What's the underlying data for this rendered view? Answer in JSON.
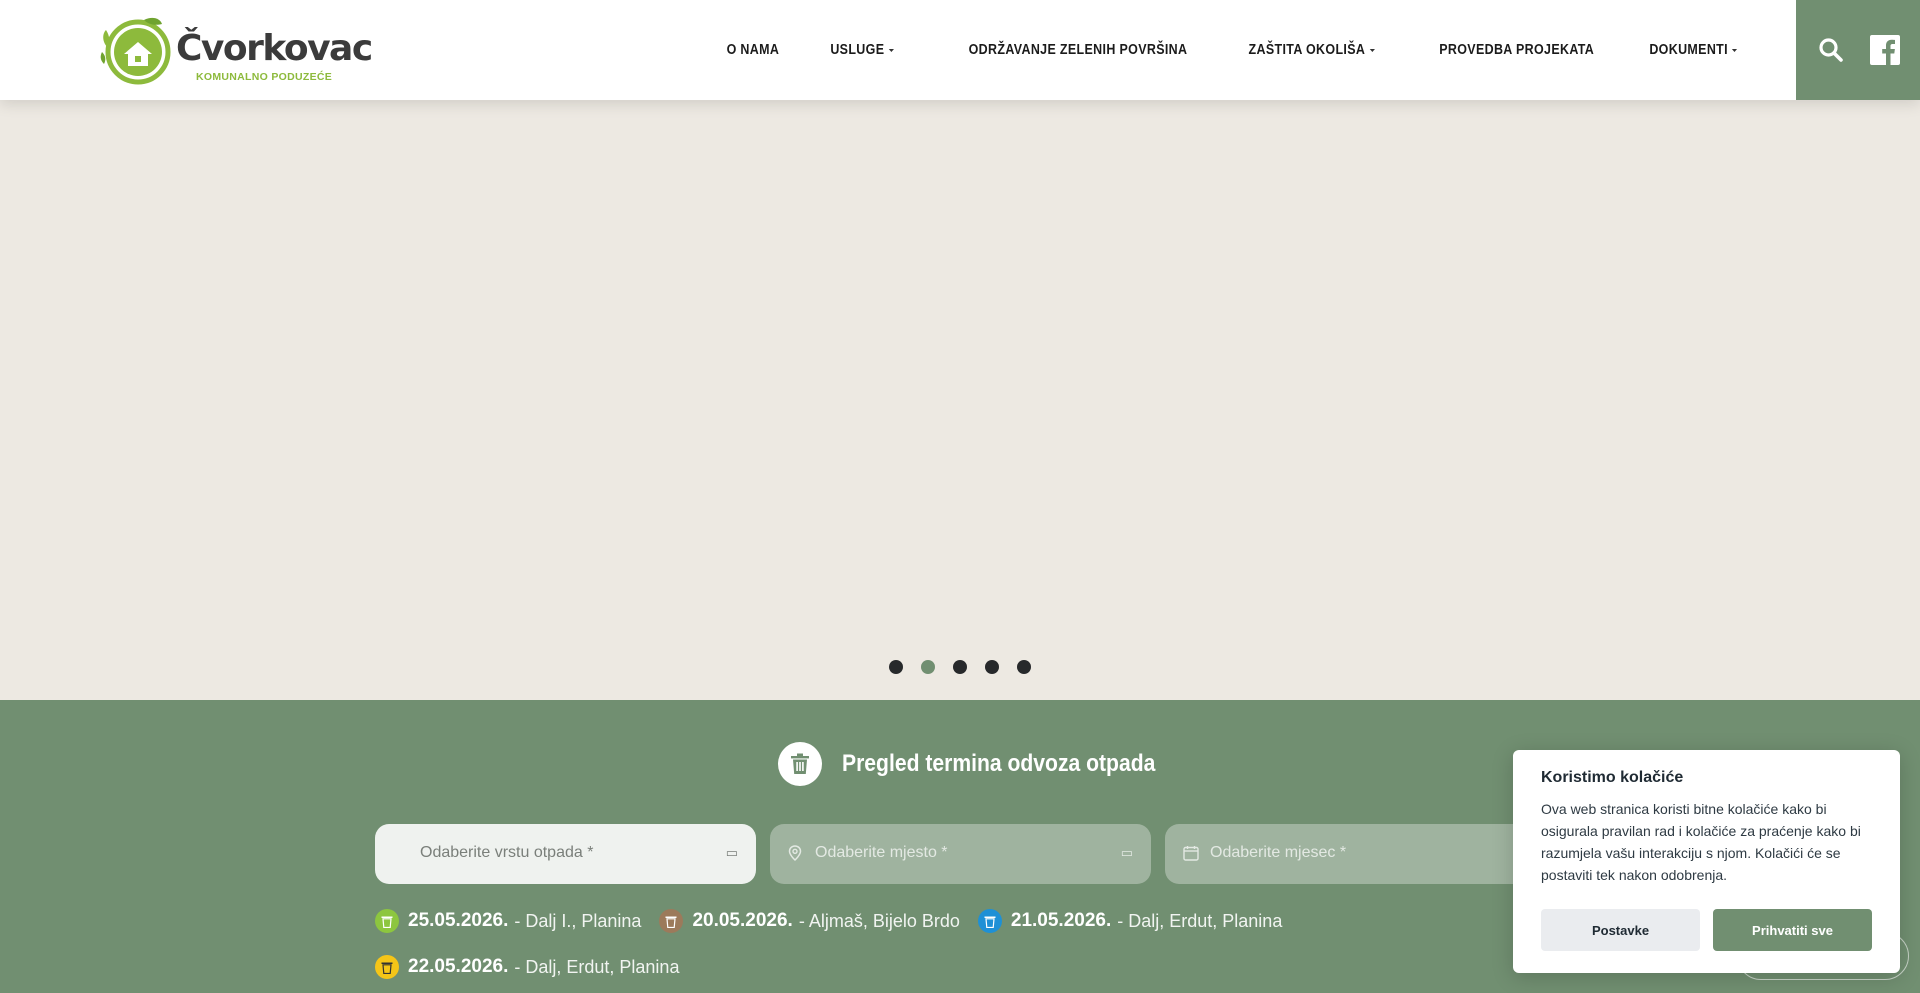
{
  "brand": {
    "name": "Čvorkovac",
    "subtitle": "KOMUNALNO PODUZEĆE",
    "colors": {
      "green": "#718f71",
      "logo_green": "#8dba3c",
      "text_dark": "#1b1b1b"
    }
  },
  "nav": {
    "items": [
      {
        "label": "O NAMA",
        "dropdown": false
      },
      {
        "label": "USLUGE",
        "dropdown": true
      },
      {
        "label": "ODRŽAVANJE ZELENIH POVRŠINA",
        "dropdown": false
      },
      {
        "label": "ZAŠTITA OKOLIŠA",
        "dropdown": true
      },
      {
        "label": "PROVEDBA PROJEKATA",
        "dropdown": false
      },
      {
        "label": "DOKUMENTI",
        "dropdown": true
      }
    ],
    "actions": [
      "search-icon",
      "facebook-icon"
    ]
  },
  "hero": {
    "slides_count": 5,
    "active_slide": 2
  },
  "waste": {
    "title": "Pregled termina odvoza otpada",
    "selects": {
      "type_placeholder": "Odaberite vrstu otpada *",
      "place_placeholder": "Odaberite mjesto *",
      "month_placeholder": "Odaberite mjesec *"
    },
    "schedule": [
      {
        "date": "25.05.2026.",
        "places": "- Dalj I., Planina",
        "icon_color": "#8dc63f"
      },
      {
        "date": "20.05.2026.",
        "places": "- Aljmaš, Bijelo Brdo",
        "icon_color": "#9c7a5b"
      },
      {
        "date": "21.05.2026.",
        "places": "- Dalj, Erdut, Planina",
        "icon_color": "#1e90d6"
      },
      {
        "date": "22.05.2026.",
        "places": "- Dalj, Erdut, Planina",
        "icon_color": "#f5c518"
      }
    ]
  },
  "cookie": {
    "title": "Koristimo kolačiće",
    "text": "Ova web stranica koristi bitne kolačiće kako bi osigurala pravilan rad i kolačiće za praćenje kako bi razumjela vašu interakciju s njom. Kolačići će se postaviti tek nakon odobrenja.",
    "settings_label": "Postavke",
    "accept_label": "Prihvatiti sve"
  }
}
